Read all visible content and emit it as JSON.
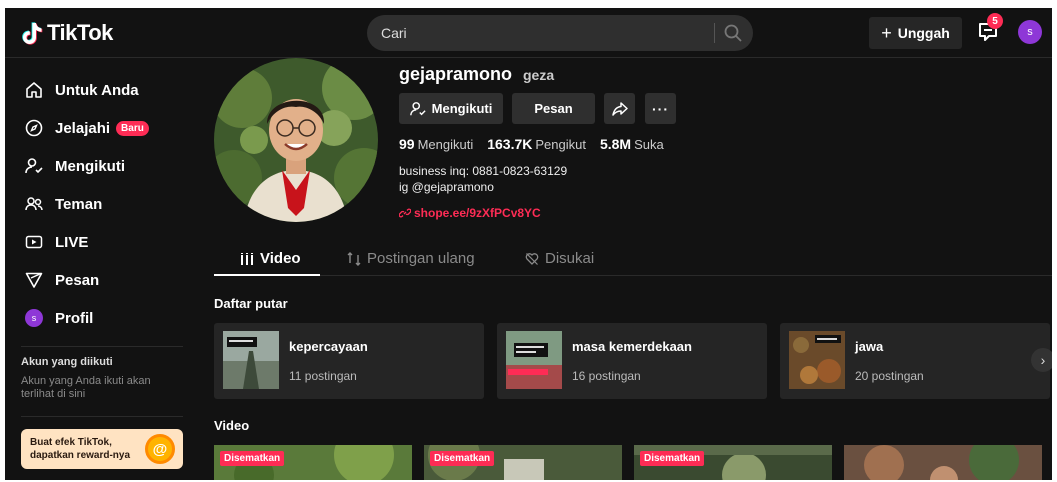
{
  "header": {
    "logo": "TikTok",
    "search_placeholder": "Cari",
    "upload_label": "Unggah",
    "inbox_count": "5",
    "avatar_initial": "s"
  },
  "sidebar": {
    "items": [
      {
        "label": "Untuk Anda",
        "icon": "home-icon"
      },
      {
        "label": "Jelajahi",
        "icon": "compass-icon",
        "badge": "Baru"
      },
      {
        "label": "Mengikuti",
        "icon": "user-follow-icon"
      },
      {
        "label": "Teman",
        "icon": "friends-icon"
      },
      {
        "label": "LIVE",
        "icon": "live-icon"
      },
      {
        "label": "Pesan",
        "icon": "send-icon"
      },
      {
        "label": "Profil",
        "icon": "profile-avatar",
        "avatar_initial": "s"
      }
    ],
    "following_heading": "Akun yang diikuti",
    "following_note": "Akun yang Anda ikuti akan terlihat di sini",
    "promo": "Buat efek TikTok, dapatkan reward-nya"
  },
  "profile": {
    "username": "gejapramono",
    "nickname": "geza",
    "following_button": "Mengikuti",
    "message_button": "Pesan",
    "stats": [
      {
        "value": "99",
        "label": "Mengikuti"
      },
      {
        "value": "163.7K",
        "label": "Pengikut"
      },
      {
        "value": "5.8M",
        "label": "Suka"
      }
    ],
    "bio_line1": "business inq: 0881-0823-63129",
    "bio_line2": "ig @gejapramono",
    "link": "shope.ee/9zXfPCv8YC"
  },
  "tabs": [
    {
      "label": "Video",
      "active": true
    },
    {
      "label": "Postingan ulang",
      "active": false
    },
    {
      "label": "Disukai",
      "active": false
    }
  ],
  "playlists_title": "Daftar putar",
  "playlists": [
    {
      "name": "kepercayaan",
      "count": "11 postingan"
    },
    {
      "name": "masa kemerdekaan",
      "count": "16 postingan"
    },
    {
      "name": "jawa",
      "count": "20 postingan"
    }
  ],
  "videos_title": "Video",
  "videos": [
    {
      "pinned_label": "Disematkan"
    },
    {
      "pinned_label": "Disematkan"
    },
    {
      "pinned_label": "Disematkan"
    },
    {
      "pinned_label": ""
    }
  ],
  "colors": {
    "background": "#121212",
    "accent": "#fe2c55",
    "button": "#2f2f2f",
    "avatar": "#8e37d7"
  }
}
